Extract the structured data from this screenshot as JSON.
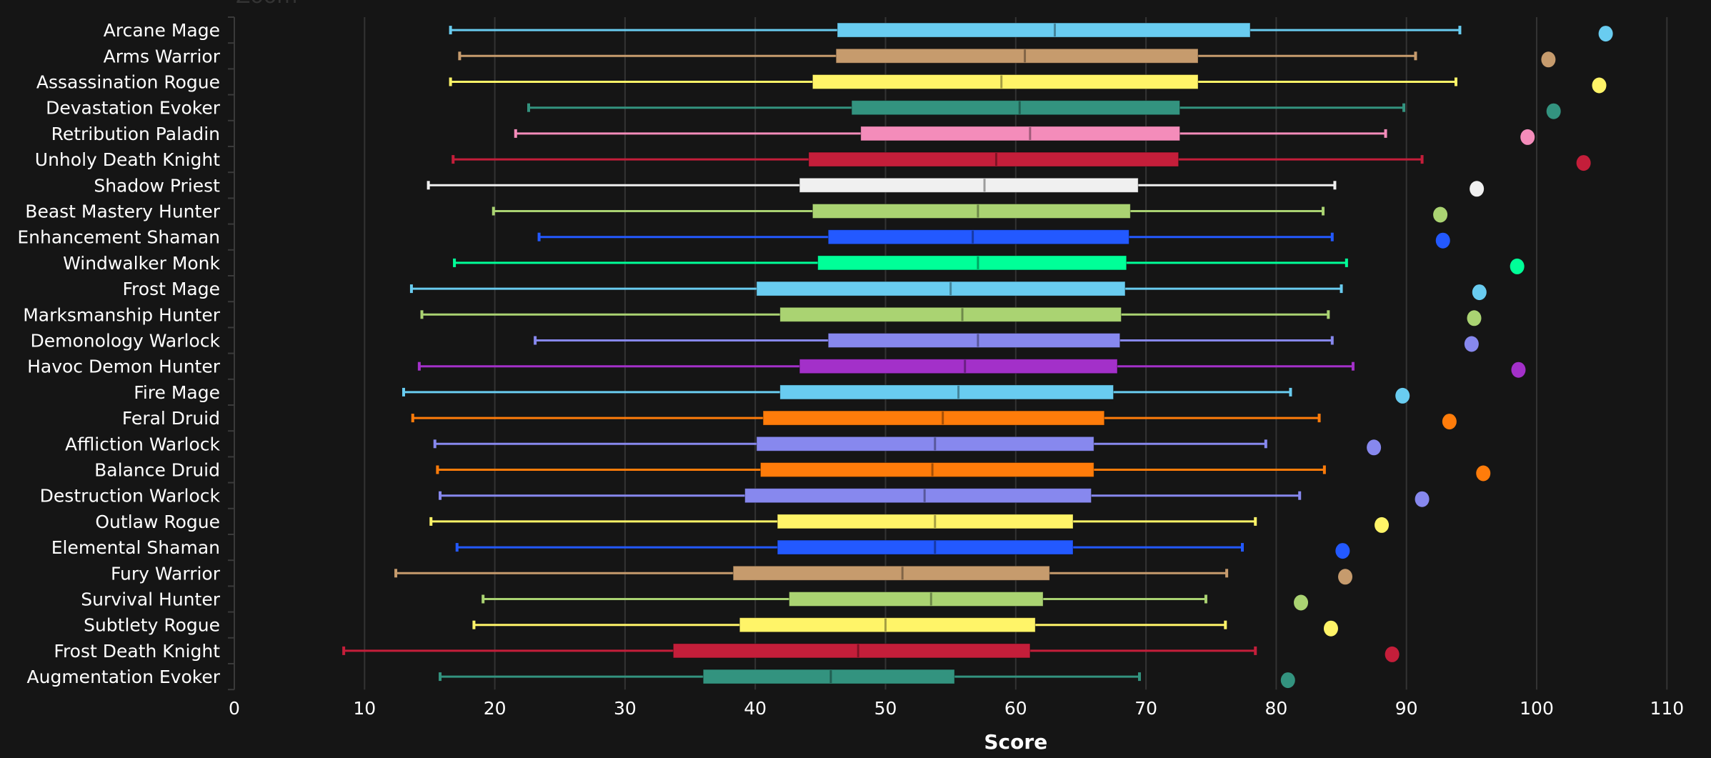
{
  "chart_data": {
    "type": "boxplot",
    "title": "",
    "top_partial_label": "Zoom",
    "xlabel": "Score",
    "ylabel": "",
    "xlim": [
      0,
      113.5
    ],
    "xticks": [
      0,
      10,
      20,
      30,
      40,
      50,
      60,
      70,
      80,
      90,
      100,
      110
    ],
    "grid": "vertical",
    "background": "#151515",
    "series": [
      {
        "name": "Arcane Mage",
        "color": "#69CCF0",
        "min": 16.6,
        "q1": 46.3,
        "median": 63.0,
        "q3": 78.0,
        "max": 94.1,
        "point": 105.3
      },
      {
        "name": "Arms Warrior",
        "color": "#C69B6D",
        "min": 17.3,
        "q1": 46.2,
        "median": 60.7,
        "q3": 74.0,
        "max": 90.7,
        "point": 100.9
      },
      {
        "name": "Assassination Rogue",
        "color": "#FFF468",
        "min": 16.6,
        "q1": 44.4,
        "median": 58.9,
        "q3": 74.0,
        "max": 93.8,
        "point": 104.8
      },
      {
        "name": "Devastation Evoker",
        "color": "#33937F",
        "min": 22.6,
        "q1": 47.4,
        "median": 60.3,
        "q3": 72.6,
        "max": 89.8,
        "point": 101.3
      },
      {
        "name": "Retribution Paladin",
        "color": "#F48CBA",
        "min": 21.6,
        "q1": 48.1,
        "median": 61.1,
        "q3": 72.6,
        "max": 88.4,
        "point": 99.3
      },
      {
        "name": "Unholy Death Knight",
        "color": "#C41E3A",
        "min": 16.8,
        "q1": 44.1,
        "median": 58.5,
        "q3": 72.5,
        "max": 91.2,
        "point": 103.6
      },
      {
        "name": "Shadow Priest",
        "color": "#F0F0F0",
        "min": 14.9,
        "q1": 43.4,
        "median": 57.6,
        "q3": 69.4,
        "max": 84.5,
        "point": 95.4
      },
      {
        "name": "Beast Mastery Hunter",
        "color": "#AAD372",
        "min": 19.9,
        "q1": 44.4,
        "median": 57.1,
        "q3": 68.8,
        "max": 83.6,
        "point": 92.6
      },
      {
        "name": "Enhancement Shaman",
        "color": "#2359FF",
        "min": 23.4,
        "q1": 45.6,
        "median": 56.7,
        "q3": 68.7,
        "max": 84.3,
        "point": 92.8
      },
      {
        "name": "Windwalker Monk",
        "color": "#00FF98",
        "min": 16.9,
        "q1": 44.8,
        "median": 57.1,
        "q3": 68.5,
        "max": 85.4,
        "point": 98.5
      },
      {
        "name": "Frost Mage",
        "color": "#69CCF0",
        "min": 13.6,
        "q1": 40.1,
        "median": 55.0,
        "q3": 68.4,
        "max": 85.0,
        "point": 95.6
      },
      {
        "name": "Marksmanship Hunter",
        "color": "#AAD372",
        "min": 14.4,
        "q1": 41.9,
        "median": 55.9,
        "q3": 68.1,
        "max": 84.0,
        "point": 95.2
      },
      {
        "name": "Demonology Warlock",
        "color": "#8788EE",
        "min": 23.1,
        "q1": 45.6,
        "median": 57.1,
        "q3": 68.0,
        "max": 84.3,
        "point": 95.0
      },
      {
        "name": "Havoc Demon Hunter",
        "color": "#A330C9",
        "min": 14.2,
        "q1": 43.4,
        "median": 56.1,
        "q3": 67.8,
        "max": 85.9,
        "point": 98.6
      },
      {
        "name": "Fire Mage",
        "color": "#69CCF0",
        "min": 13.0,
        "q1": 41.9,
        "median": 55.6,
        "q3": 67.5,
        "max": 81.1,
        "point": 89.7
      },
      {
        "name": "Feral Druid",
        "color": "#FF7C0A",
        "min": 13.7,
        "q1": 40.6,
        "median": 54.4,
        "q3": 66.8,
        "max": 83.3,
        "point": 93.3
      },
      {
        "name": "Affliction Warlock",
        "color": "#8788EE",
        "min": 15.4,
        "q1": 40.1,
        "median": 53.8,
        "q3": 66.0,
        "max": 79.2,
        "point": 87.5
      },
      {
        "name": "Balance Druid",
        "color": "#FF7C0A",
        "min": 15.6,
        "q1": 40.4,
        "median": 53.6,
        "q3": 66.0,
        "max": 83.7,
        "point": 95.9
      },
      {
        "name": "Destruction Warlock",
        "color": "#8788EE",
        "min": 15.8,
        "q1": 39.2,
        "median": 53.0,
        "q3": 65.8,
        "max": 81.8,
        "point": 91.2
      },
      {
        "name": "Outlaw Rogue",
        "color": "#FFF468",
        "min": 15.1,
        "q1": 41.7,
        "median": 53.8,
        "q3": 64.4,
        "max": 78.4,
        "point": 88.1
      },
      {
        "name": "Elemental Shaman",
        "color": "#2359FF",
        "min": 17.1,
        "q1": 41.7,
        "median": 53.8,
        "q3": 64.4,
        "max": 77.4,
        "point": 85.1
      },
      {
        "name": "Fury Warrior",
        "color": "#C69B6D",
        "min": 12.4,
        "q1": 38.3,
        "median": 51.3,
        "q3": 62.6,
        "max": 76.2,
        "point": 85.3
      },
      {
        "name": "Survival Hunter",
        "color": "#AAD372",
        "min": 19.1,
        "q1": 42.6,
        "median": 53.5,
        "q3": 62.1,
        "max": 74.6,
        "point": 81.9
      },
      {
        "name": "Subtlety Rogue",
        "color": "#FFF468",
        "min": 18.4,
        "q1": 38.8,
        "median": 50.0,
        "q3": 61.5,
        "max": 76.1,
        "point": 84.2
      },
      {
        "name": "Frost Death Knight",
        "color": "#C41E3A",
        "min": 8.4,
        "q1": 33.7,
        "median": 47.9,
        "q3": 61.1,
        "max": 78.4,
        "point": 88.9
      },
      {
        "name": "Augmentation Evoker",
        "color": "#33937F",
        "min": 15.8,
        "q1": 36.0,
        "median": 45.8,
        "q3": 55.3,
        "max": 69.5,
        "point": 80.9
      }
    ]
  }
}
